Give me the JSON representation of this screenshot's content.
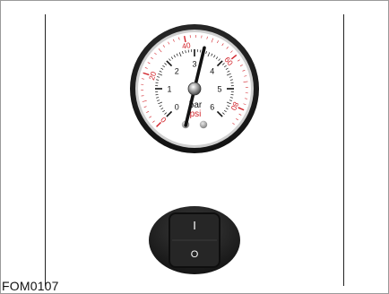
{
  "figure": {
    "code": "FOM0107"
  },
  "gauge": {
    "unit_bar": "bar",
    "unit_psi": "psi",
    "bar_scale": [
      "0",
      "1",
      "2",
      "3",
      "4",
      "5",
      "6"
    ],
    "psi_scale": [
      "0",
      "20",
      "40",
      "60",
      "80"
    ],
    "needle_value_bar": 3.3,
    "colors": {
      "bar_scale": "#111111",
      "psi_scale": "#d2232a",
      "bezel": "#1e1e1e",
      "face": "#ffffff"
    }
  },
  "switch": {
    "on_symbol": "I",
    "off_symbol": "O",
    "colors": {
      "body": "#1c1c1c",
      "rocker": "#2c2c2c",
      "symbol": "#ffffff"
    }
  }
}
